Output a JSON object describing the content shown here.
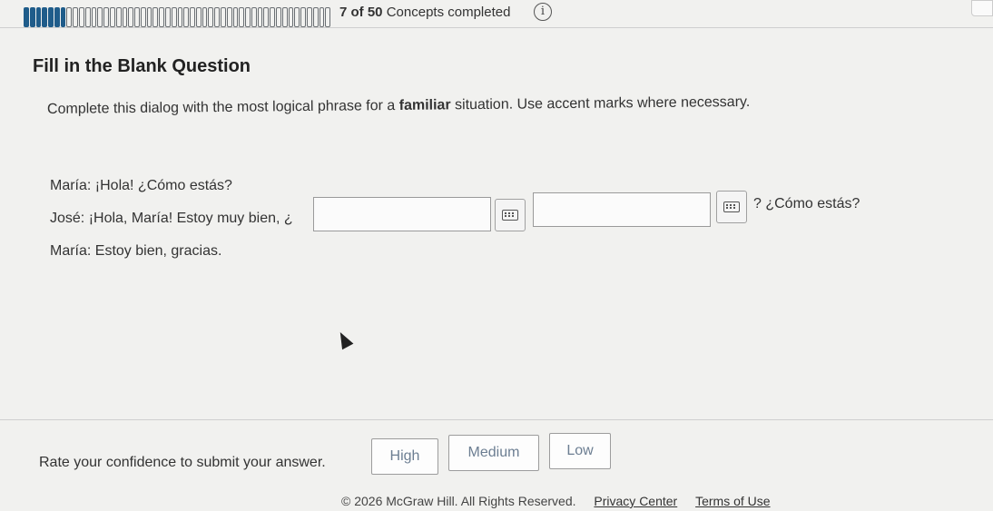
{
  "progress": {
    "completed": 7,
    "total": 50,
    "text_count": "7 of 50",
    "text_suffix": "Concepts completed",
    "fill_color": "#1f5c8a"
  },
  "icons": {
    "info": "info-icon",
    "keyboard": "keyboard-icon"
  },
  "question": {
    "heading": "Fill in the Blank Question",
    "instruction_before": "Complete this dialog with the most logical phrase for a ",
    "instruction_bold": "familiar",
    "instruction_after": " situation. Use accent marks where necessary.",
    "line1": "María: ¡Hola! ¿Cómo estás?",
    "line2_before": "José: ¡Hola, María! Estoy muy bien, ¿",
    "line2_after": "? ¿Cómo estás?",
    "line3": "María: Estoy bien, gracias.",
    "blank1_value": "",
    "blank2_value": ""
  },
  "confidence": {
    "label": "Rate your confidence to submit your answer.",
    "high": "High",
    "medium": "Medium",
    "low": "Low"
  },
  "footer": {
    "copyright": "© 2026 McGraw Hill. All Rights Reserved.",
    "privacy": "Privacy Center",
    "terms": "Terms of Use"
  }
}
